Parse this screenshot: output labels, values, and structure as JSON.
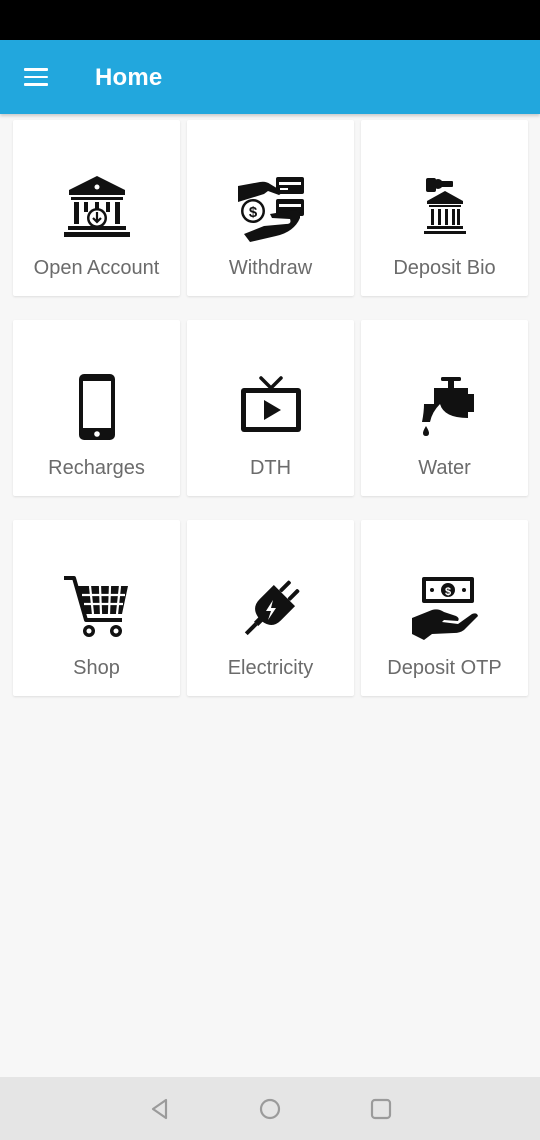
{
  "app_bar": {
    "title": "Home",
    "menu_icon": "menu-icon"
  },
  "tiles": [
    {
      "label": "Open Account",
      "icon": "bank-icon"
    },
    {
      "label": "Withdraw",
      "icon": "cash-hand-icon"
    },
    {
      "label": "Deposit Bio",
      "icon": "bank-deposit-icon"
    },
    {
      "label": "Recharges",
      "icon": "smartphone-icon"
    },
    {
      "label": "DTH",
      "icon": "tv-icon"
    },
    {
      "label": "Water",
      "icon": "water-tap-icon"
    },
    {
      "label": "Shop",
      "icon": "shopping-cart-icon"
    },
    {
      "label": "Electricity",
      "icon": "electric-plug-icon"
    },
    {
      "label": "Deposit OTP",
      "icon": "money-hand-icon"
    }
  ],
  "nav_bar": {
    "icons": [
      "back-icon",
      "home-icon",
      "recents-icon"
    ]
  },
  "colors": {
    "app_bar": "#22a7dd",
    "background": "#f7f7f7",
    "icon": "#111111",
    "label": "#6b6b6b"
  }
}
